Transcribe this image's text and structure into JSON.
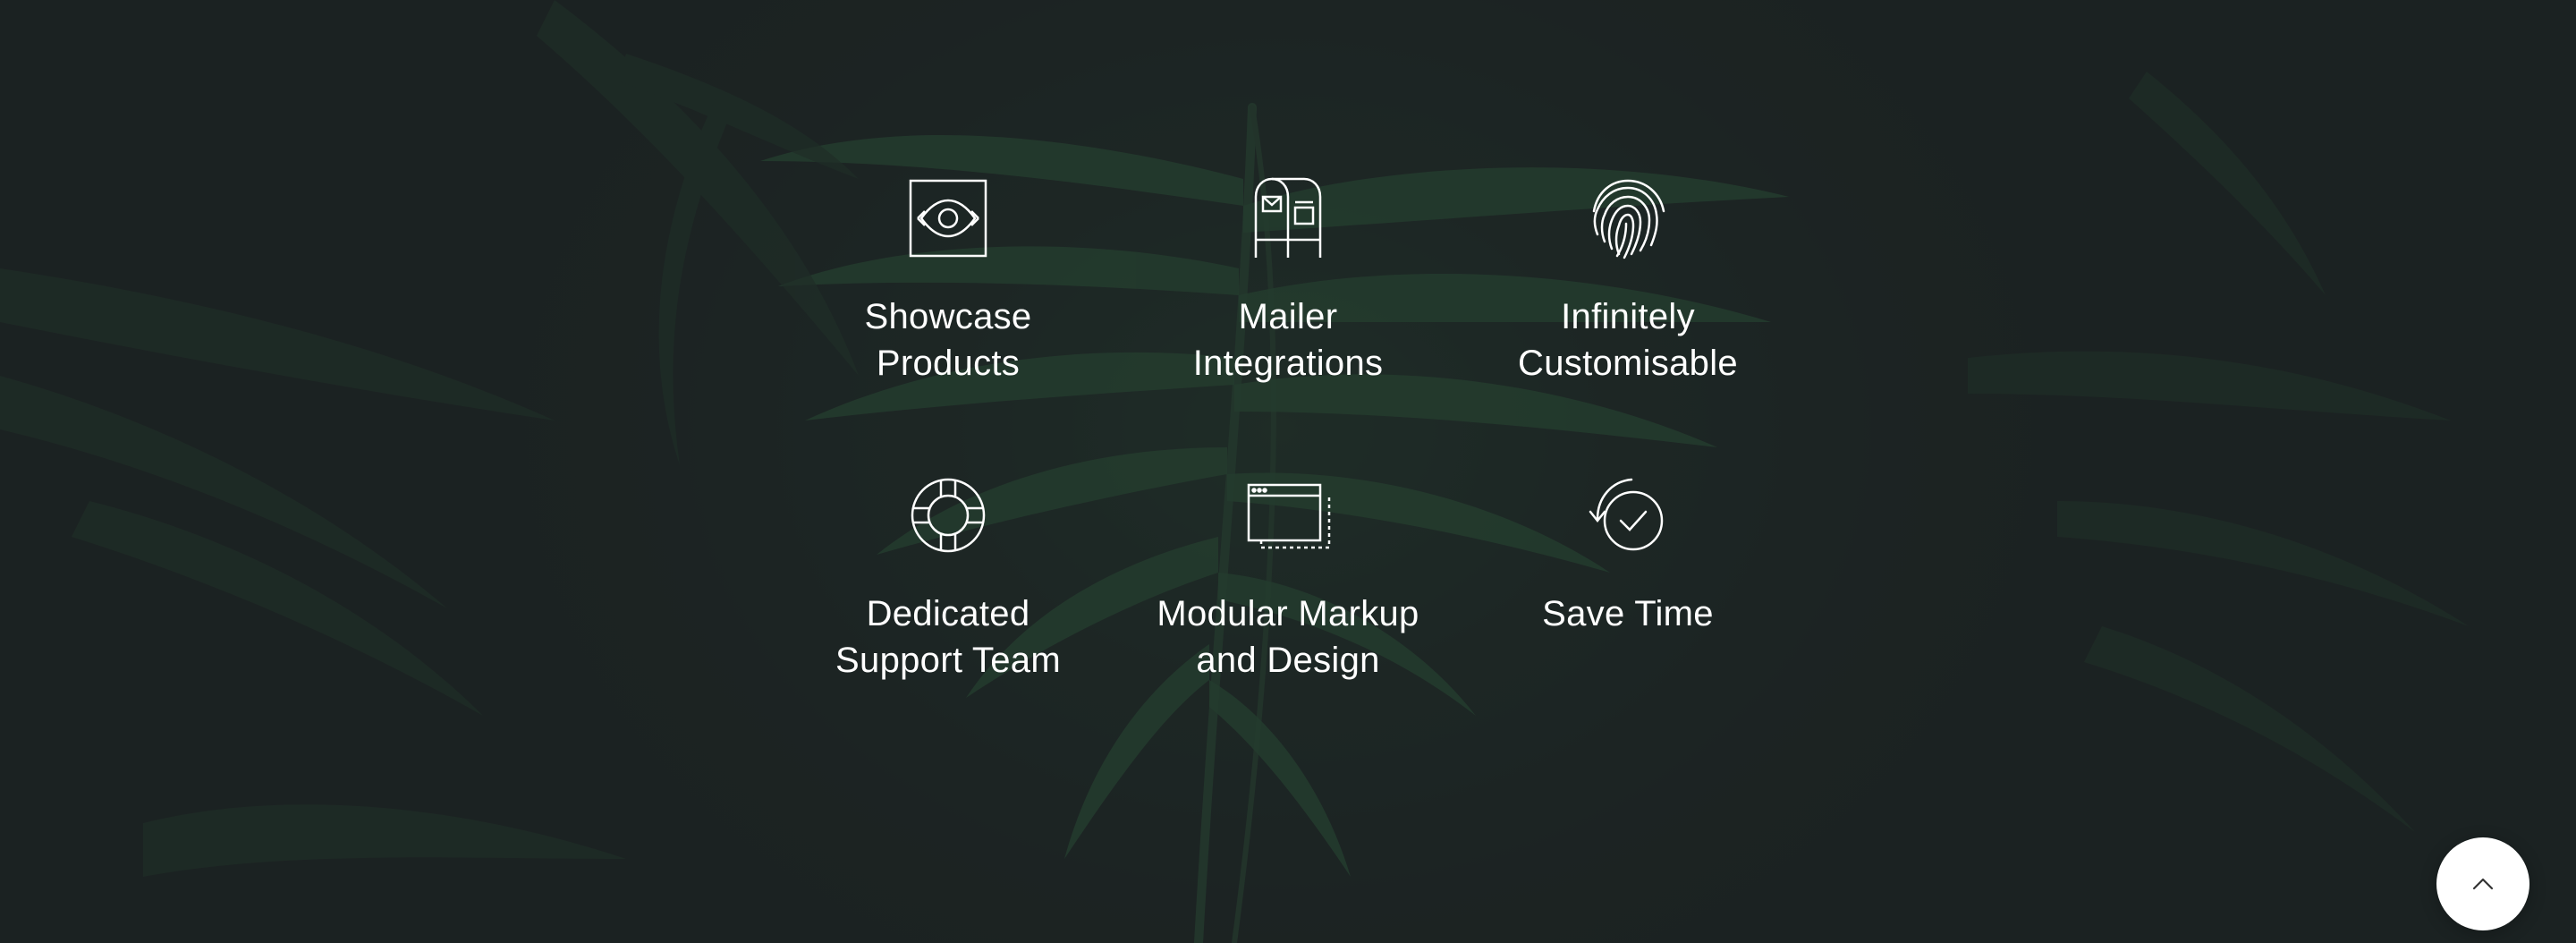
{
  "features": [
    {
      "icon": "eye-icon",
      "label": "Showcase Products"
    },
    {
      "icon": "mailbox-icon",
      "label": "Mailer Integrations"
    },
    {
      "icon": "fingerprint-icon",
      "label": "Infinitely Customisable"
    },
    {
      "icon": "lifebuoy-icon",
      "label": "Dedicated Support Team"
    },
    {
      "icon": "browser-window-icon",
      "label": "Modular Markup and Design"
    },
    {
      "icon": "clock-refresh-icon",
      "label": "Save Time"
    }
  ],
  "scroll_top": {
    "icon": "chevron-up-icon"
  },
  "colors": {
    "background": "#1f2726",
    "foliage": "#2f5a3c",
    "text": "#ffffff",
    "button": "#ffffff"
  }
}
